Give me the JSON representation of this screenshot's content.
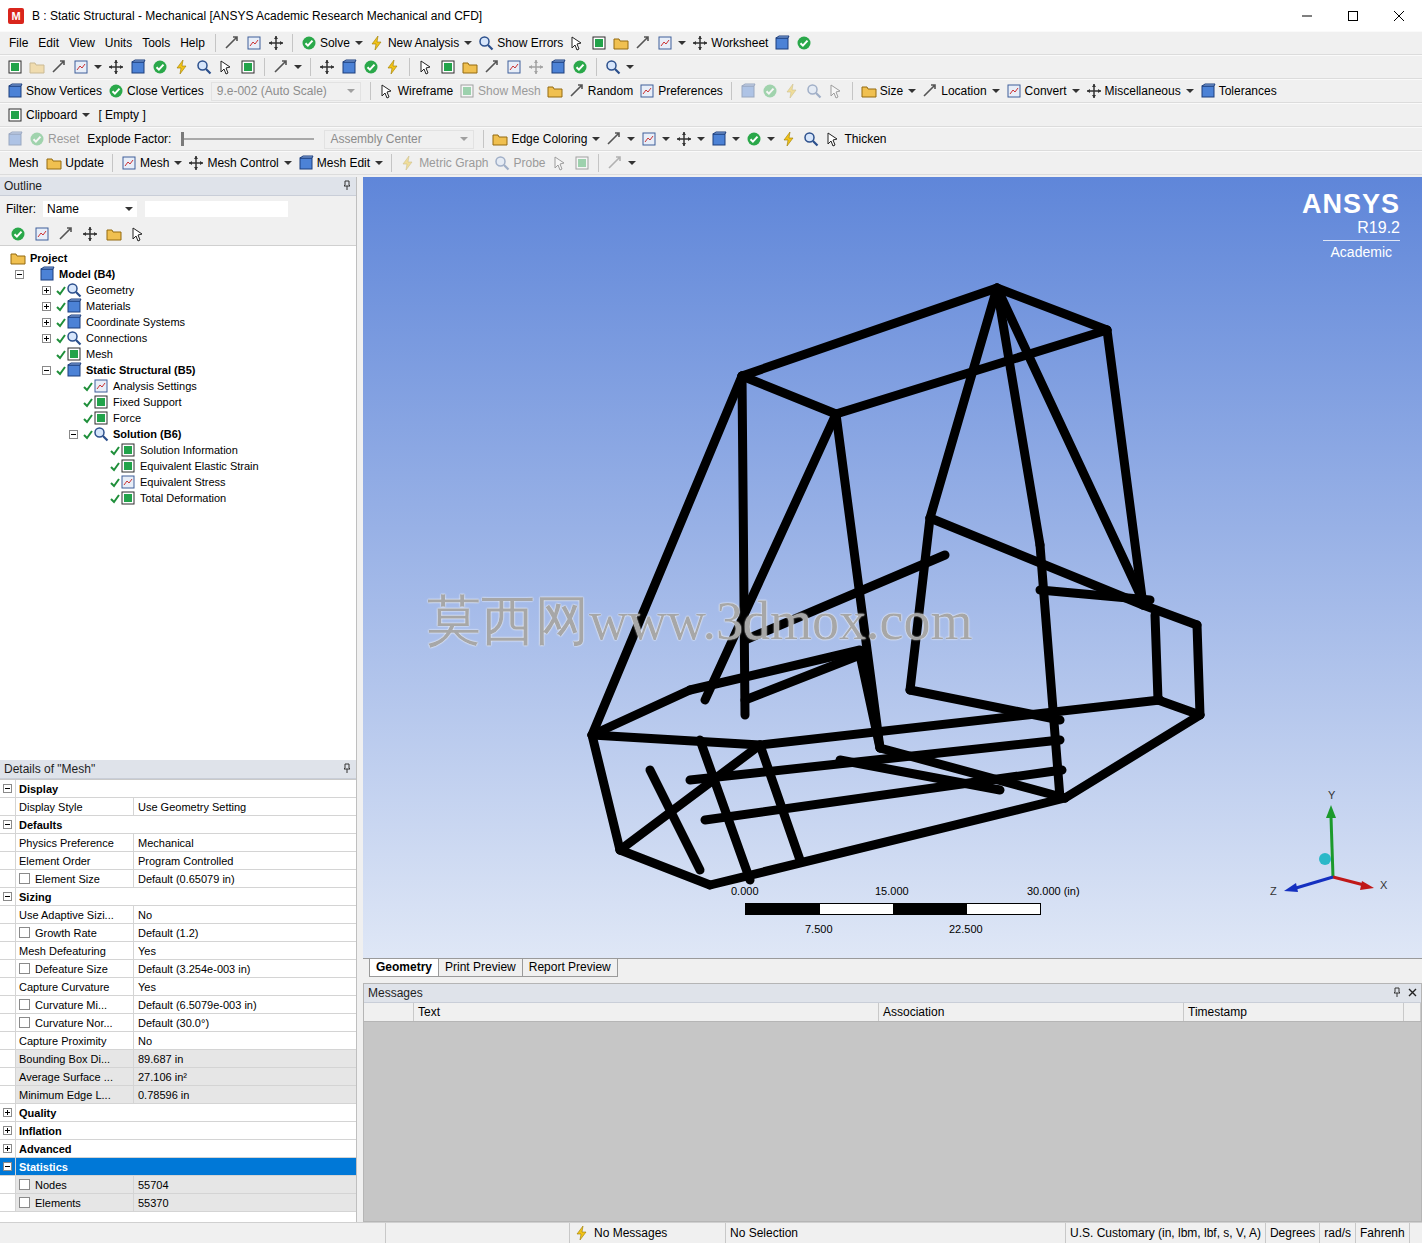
{
  "window": {
    "icon": "M",
    "title": "B : Static Structural - Mechanical [ANSYS Academic Research Mechanical and CFD]"
  },
  "toolbars": [
    {
      "items": [
        {
          "kind": "menu",
          "label": "File"
        },
        {
          "kind": "menu",
          "label": "Edit"
        },
        {
          "kind": "menu",
          "label": "View"
        },
        {
          "kind": "menu",
          "label": "Units"
        },
        {
          "kind": "menu",
          "label": "Tools"
        },
        {
          "kind": "menu",
          "label": "Help"
        },
        {
          "kind": "sep"
        },
        {
          "kind": "icon",
          "disabled": false,
          "dropdown": false
        },
        {
          "kind": "icon",
          "disabled": false,
          "dropdown": false
        },
        {
          "kind": "icon",
          "disabled": false,
          "dropdown": false
        },
        {
          "kind": "sep"
        },
        {
          "kind": "button",
          "label": "Solve",
          "disabled": false,
          "dropdown": true
        },
        {
          "kind": "button",
          "label": "New Analysis",
          "disabled": false,
          "dropdown": true
        },
        {
          "kind": "button",
          "label": "Show Errors",
          "disabled": false,
          "dropdown": false
        },
        {
          "kind": "icon",
          "disabled": false,
          "dropdown": false
        },
        {
          "kind": "icon",
          "disabled": false,
          "dropdown": false
        },
        {
          "kind": "icon",
          "disabled": false,
          "dropdown": false
        },
        {
          "kind": "icon",
          "disabled": false,
          "dropdown": false
        },
        {
          "kind": "icon",
          "disabled": false,
          "dropdown": true
        },
        {
          "kind": "button",
          "label": "Worksheet",
          "disabled": false,
          "dropdown": false
        },
        {
          "kind": "icon",
          "disabled": false,
          "dropdown": false
        },
        {
          "kind": "icon",
          "disabled": false,
          "dropdown": false
        }
      ]
    },
    {
      "items": [
        {
          "kind": "icon",
          "disabled": false,
          "dropdown": false
        },
        {
          "kind": "icon",
          "disabled": true,
          "dropdown": false
        },
        {
          "kind": "icon",
          "disabled": false,
          "dropdown": false
        },
        {
          "kind": "icon",
          "disabled": false,
          "dropdown": true
        },
        {
          "kind": "icon",
          "disabled": false,
          "dropdown": false
        },
        {
          "kind": "icon",
          "disabled": false,
          "dropdown": false
        },
        {
          "kind": "icon",
          "disabled": false,
          "dropdown": false
        },
        {
          "kind": "icon",
          "disabled": false,
          "dropdown": false
        },
        {
          "kind": "icon",
          "disabled": false,
          "dropdown": false
        },
        {
          "kind": "icon",
          "disabled": false,
          "dropdown": false
        },
        {
          "kind": "icon",
          "disabled": false,
          "dropdown": false
        },
        {
          "kind": "sep"
        },
        {
          "kind": "icon",
          "disabled": false,
          "dropdown": true
        },
        {
          "kind": "sep"
        },
        {
          "kind": "icon",
          "disabled": false,
          "dropdown": false
        },
        {
          "kind": "icon",
          "disabled": false,
          "dropdown": false
        },
        {
          "kind": "icon",
          "disabled": false,
          "dropdown": false
        },
        {
          "kind": "icon",
          "disabled": false,
          "dropdown": false
        },
        {
          "kind": "sep"
        },
        {
          "kind": "icon",
          "disabled": false,
          "dropdown": false
        },
        {
          "kind": "icon",
          "disabled": false,
          "dropdown": false
        },
        {
          "kind": "icon",
          "disabled": false,
          "dropdown": false
        },
        {
          "kind": "icon",
          "disabled": false,
          "dropdown": false
        },
        {
          "kind": "icon",
          "disabled": false,
          "dropdown": false
        },
        {
          "kind": "icon",
          "disabled": true,
          "dropdown": false
        },
        {
          "kind": "icon",
          "disabled": false,
          "dropdown": false
        },
        {
          "kind": "icon",
          "disabled": false,
          "dropdown": false
        },
        {
          "kind": "sep"
        },
        {
          "kind": "icon",
          "disabled": false,
          "dropdown": true
        }
      ]
    },
    {
      "items": [
        {
          "kind": "button",
          "label": "Show Vertices",
          "disabled": false,
          "dropdown": false
        },
        {
          "kind": "button",
          "label": "Close Vertices",
          "disabled": false,
          "dropdown": false
        },
        {
          "kind": "combo",
          "label": "9.e-002 (Auto Scale)",
          "disabled": true,
          "dropdown": true
        },
        {
          "kind": "sep"
        },
        {
          "kind": "button",
          "label": "Wireframe",
          "disabled": false,
          "dropdown": false
        },
        {
          "kind": "button",
          "label": "Show Mesh",
          "disabled": true,
          "dropdown": false
        },
        {
          "kind": "icon",
          "disabled": false,
          "dropdown": false
        },
        {
          "kind": "button",
          "label": "Random",
          "disabled": false,
          "dropdown": false
        },
        {
          "kind": "button",
          "label": "Preferences",
          "disabled": false,
          "dropdown": false
        },
        {
          "kind": "sep"
        },
        {
          "kind": "icon",
          "disabled": true,
          "dropdown": false
        },
        {
          "kind": "icon",
          "disabled": true,
          "dropdown": false
        },
        {
          "kind": "icon",
          "disabled": true,
          "dropdown": false
        },
        {
          "kind": "icon",
          "disabled": true,
          "dropdown": false
        },
        {
          "kind": "icon",
          "disabled": true,
          "dropdown": false
        },
        {
          "kind": "sep"
        },
        {
          "kind": "button",
          "label": "Size",
          "disabled": false,
          "dropdown": true
        },
        {
          "kind": "button",
          "label": "Location",
          "disabled": false,
          "dropdown": true
        },
        {
          "kind": "button",
          "label": "Convert",
          "disabled": false,
          "dropdown": true
        },
        {
          "kind": "button",
          "label": "Miscellaneous",
          "disabled": false,
          "dropdown": true
        },
        {
          "kind": "button",
          "label": "Tolerances",
          "disabled": false,
          "dropdown": false
        }
      ]
    },
    {
      "items": [
        {
          "kind": "button",
          "label": "Clipboard",
          "disabled": false,
          "dropdown": true
        },
        {
          "kind": "label",
          "label": "[ Empty ]"
        }
      ]
    },
    {
      "items": [
        {
          "kind": "icon",
          "disabled": true,
          "dropdown": false
        },
        {
          "kind": "button",
          "label": "Reset",
          "disabled": true,
          "dropdown": false
        },
        {
          "kind": "label",
          "label": "Explode Factor:"
        },
        {
          "kind": "slider",
          "level": 0
        },
        {
          "kind": "combo",
          "label": "Assembly Center",
          "disabled": true,
          "dropdown": true
        },
        {
          "kind": "sep"
        },
        {
          "kind": "button",
          "label": "Edge Coloring",
          "disabled": false,
          "dropdown": true
        },
        {
          "kind": "icon",
          "disabled": false,
          "dropdown": true
        },
        {
          "kind": "icon",
          "disabled": false,
          "dropdown": true
        },
        {
          "kind": "icon",
          "disabled": false,
          "dropdown": true
        },
        {
          "kind": "icon",
          "disabled": false,
          "dropdown": true
        },
        {
          "kind": "icon",
          "disabled": false,
          "dropdown": true
        },
        {
          "kind": "icon",
          "disabled": false,
          "dropdown": false
        },
        {
          "kind": "icon",
          "disabled": false,
          "dropdown": false
        },
        {
          "kind": "button",
          "label": "Thicken",
          "disabled": false,
          "dropdown": false
        }
      ]
    },
    {
      "items": [
        {
          "kind": "label",
          "label": "Mesh"
        },
        {
          "kind": "button",
          "label": "Update",
          "disabled": false,
          "dropdown": false
        },
        {
          "kind": "sep"
        },
        {
          "kind": "button",
          "label": "Mesh",
          "disabled": false,
          "dropdown": true
        },
        {
          "kind": "button",
          "label": "Mesh Control",
          "disabled": false,
          "dropdown": true
        },
        {
          "kind": "button",
          "label": "Mesh Edit",
          "disabled": false,
          "dropdown": true
        },
        {
          "kind": "sep"
        },
        {
          "kind": "button",
          "label": "Metric Graph",
          "disabled": true,
          "dropdown": false
        },
        {
          "kind": "button",
          "label": "Probe",
          "disabled": true,
          "dropdown": false
        },
        {
          "kind": "icon",
          "disabled": true,
          "dropdown": false
        },
        {
          "kind": "icon",
          "disabled": true,
          "dropdown": false
        },
        {
          "kind": "sep"
        },
        {
          "kind": "icon",
          "disabled": true,
          "dropdown": true
        }
      ]
    }
  ],
  "outline": {
    "title": "Outline",
    "filter_label": "Filter:",
    "filter_field": "Name"
  },
  "tree": [
    {
      "kind": "root",
      "label": "Project",
      "depth": 0,
      "bold": true
    },
    {
      "kind": "branch",
      "label": "Model (B4)",
      "depth": 1,
      "bold": true,
      "expanded": true,
      "checked": false
    },
    {
      "kind": "branch",
      "label": "Geometry",
      "depth": 2,
      "bold": false,
      "expanded": false,
      "checked": true
    },
    {
      "kind": "branch",
      "label": "Materials",
      "depth": 2,
      "bold": false,
      "expanded": false,
      "checked": true
    },
    {
      "kind": "branch",
      "label": "Coordinate Systems",
      "depth": 2,
      "bold": false,
      "expanded": false,
      "checked": true
    },
    {
      "kind": "branch",
      "label": "Connections",
      "depth": 2,
      "bold": false,
      "expanded": false,
      "checked": true
    },
    {
      "kind": "leaf",
      "label": "Mesh",
      "depth": 2,
      "bold": false,
      "checked": true
    },
    {
      "kind": "branch",
      "label": "Static Structural (B5)",
      "depth": 2,
      "bold": true,
      "expanded": true,
      "checked": true
    },
    {
      "kind": "leaf",
      "label": "Analysis Settings",
      "depth": 3,
      "bold": false,
      "checked": true
    },
    {
      "kind": "leaf",
      "label": "Fixed Support",
      "depth": 3,
      "bold": false,
      "checked": true
    },
    {
      "kind": "leaf",
      "label": "Force",
      "depth": 3,
      "bold": false,
      "checked": true
    },
    {
      "kind": "branch",
      "label": "Solution (B6)",
      "depth": 3,
      "bold": true,
      "expanded": true,
      "checked": true
    },
    {
      "kind": "leaf",
      "label": "Solution Information",
      "depth": 4,
      "bold": false,
      "checked": true
    },
    {
      "kind": "leaf",
      "label": "Equivalent Elastic Strain",
      "depth": 4,
      "bold": false,
      "checked": true
    },
    {
      "kind": "leaf",
      "label": "Equivalent Stress",
      "depth": 4,
      "bold": false,
      "checked": true
    },
    {
      "kind": "leaf",
      "label": "Total Deformation",
      "depth": 4,
      "bold": false,
      "checked": true
    }
  ],
  "details": {
    "title": "Details of \"Mesh\"",
    "rows": [
      {
        "kind": "section",
        "label": "Display",
        "expanded": true,
        "selected": false
      },
      {
        "kind": "row",
        "label": "Display Style",
        "value": "Use Geometry Setting",
        "readonly": false
      },
      {
        "kind": "section",
        "label": "Defaults",
        "expanded": true,
        "selected": false
      },
      {
        "kind": "row",
        "label": "Physics Preference",
        "value": "Mechanical",
        "readonly": false
      },
      {
        "kind": "row",
        "label": "Element Order",
        "value": "Program Controlled",
        "readonly": false
      },
      {
        "kind": "check-row",
        "label": "Element Size",
        "value": "Default (0.65079 in)",
        "readonly": false,
        "checked": false
      },
      {
        "kind": "section",
        "label": "Sizing",
        "expanded": true,
        "selected": false
      },
      {
        "kind": "row",
        "label": "Use Adaptive Sizi...",
        "value": "No",
        "readonly": false
      },
      {
        "kind": "check-row",
        "label": "Growth Rate",
        "value": "Default (1.2)",
        "readonly": false,
        "checked": false
      },
      {
        "kind": "row",
        "label": "Mesh Defeaturing",
        "value": "Yes",
        "readonly": false
      },
      {
        "kind": "check-row",
        "label": "Defeature Size",
        "value": "Default (3.254e-003 in)",
        "readonly": false,
        "checked": false
      },
      {
        "kind": "row",
        "label": "Capture Curvature",
        "value": "Yes",
        "readonly": false
      },
      {
        "kind": "check-row",
        "label": "Curvature Mi...",
        "value": "Default (6.5079e-003 in)",
        "readonly": false,
        "checked": false
      },
      {
        "kind": "check-row",
        "label": "Curvature Nor...",
        "value": "Default (30.0°)",
        "readonly": false,
        "checked": false
      },
      {
        "kind": "row",
        "label": "Capture Proximity",
        "value": "No",
        "readonly": false
      },
      {
        "kind": "row",
        "label": "Bounding Box Di...",
        "value": "89.687 in",
        "readonly": true
      },
      {
        "kind": "row",
        "label": "Average Surface ...",
        "value": "27.106 in²",
        "readonly": true
      },
      {
        "kind": "row",
        "label": "Minimum Edge L...",
        "value": "0.78596 in",
        "readonly": true
      },
      {
        "kind": "section",
        "label": "Quality",
        "expanded": false,
        "selected": false
      },
      {
        "kind": "section",
        "label": "Inflation",
        "expanded": false,
        "selected": false
      },
      {
        "kind": "section",
        "label": "Advanced",
        "expanded": false,
        "selected": false
      },
      {
        "kind": "section",
        "label": "Statistics",
        "expanded": true,
        "selected": true
      },
      {
        "kind": "check-row",
        "label": "Nodes",
        "value": "55704",
        "readonly": true,
        "checked": false
      },
      {
        "kind": "check-row",
        "label": "Elements",
        "value": "55370",
        "readonly": true,
        "checked": false
      }
    ]
  },
  "viewport": {
    "logo": {
      "name": "ANSYS",
      "version": "R19.2",
      "edition": "Academic"
    },
    "watermark": "莫西网www.3dmox.com",
    "scale": {
      "top": [
        "0.000",
        "15.000",
        "30.000 (in)"
      ],
      "bottom": [
        "7.500",
        "22.500"
      ]
    },
    "axes": {
      "y": "Y",
      "z": "Z",
      "x": "X"
    }
  },
  "view_tabs": [
    {
      "label": "Geometry",
      "selected": true
    },
    {
      "label": "Print Preview",
      "selected": false
    },
    {
      "label": "Report Preview",
      "selected": false
    }
  ],
  "messages": {
    "title": "Messages",
    "columns": [
      "Text",
      "Association",
      "Timestamp"
    ]
  },
  "status_bar": [
    "No Messages",
    "No Selection",
    "U.S. Customary (in, lbm, lbf, s, V, A)",
    "Degrees",
    "rad/s",
    "Fahrenh"
  ]
}
